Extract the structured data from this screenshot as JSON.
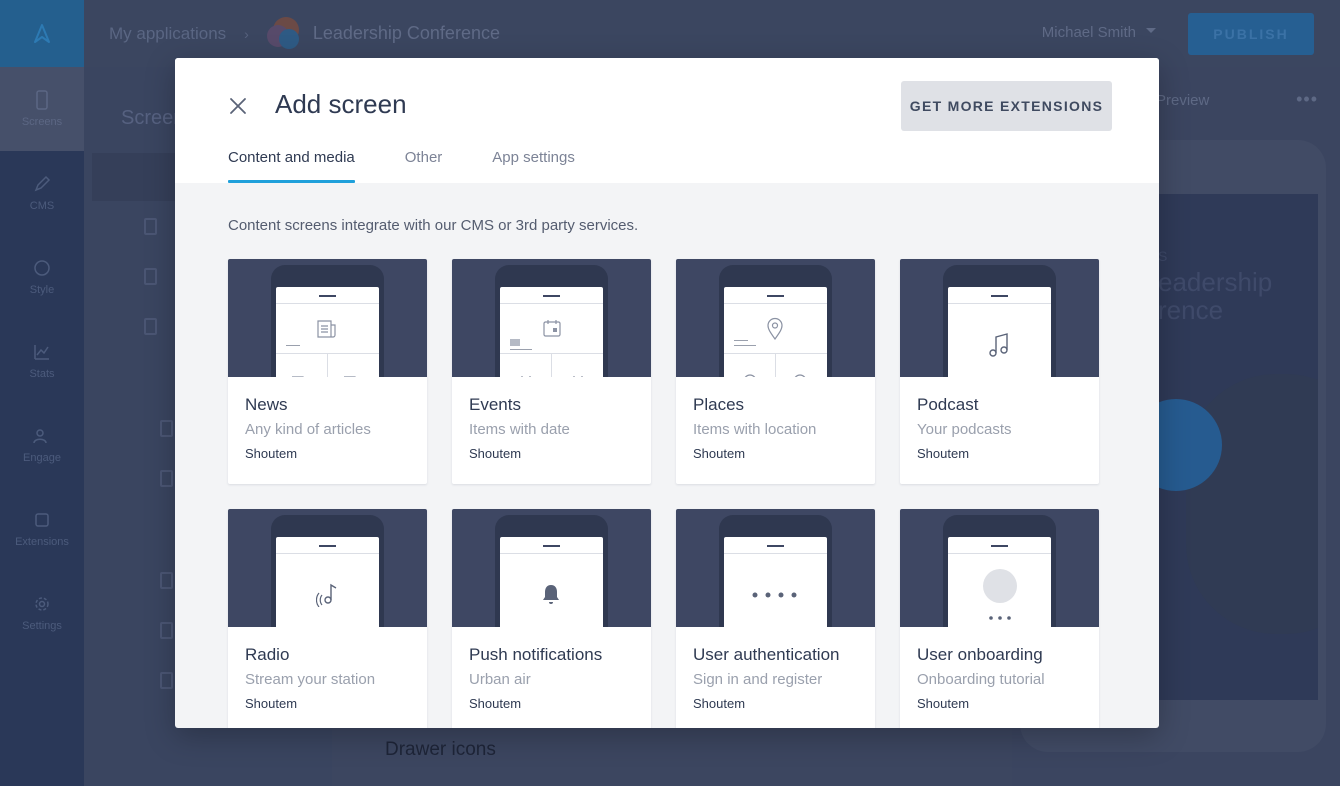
{
  "app": {
    "breadcrumb_root": "My applications",
    "app_name": "Leadership Conference",
    "user_name": "Michael Smith",
    "publish_label": "PUBLISH",
    "left_panel_title": "Screens",
    "section_label": "Drawer icons",
    "preview_label": "Preview",
    "preview_menu": "•••",
    "nav": [
      {
        "label": "Screens",
        "icon": "phone-icon"
      },
      {
        "label": "CMS",
        "icon": "pencil-icon"
      },
      {
        "label": "Style",
        "icon": "palette-icon"
      },
      {
        "label": "Stats",
        "icon": "chart-icon"
      },
      {
        "label": "Engage",
        "icon": "people-icon"
      },
      {
        "label": "Extensions",
        "icon": "puzzle-icon"
      },
      {
        "label": "Settings",
        "icon": "gear-icon"
      }
    ],
    "preview_text": [
      "S",
      "eadership",
      "rence"
    ]
  },
  "modal": {
    "title": "Add screen",
    "get_more_label": "GET MORE EXTENSIONS",
    "tabs": [
      {
        "label": "Content and media",
        "active": true
      },
      {
        "label": "Other",
        "active": false
      },
      {
        "label": "App settings",
        "active": false
      }
    ],
    "intro": "Content screens integrate with our CMS or 3rd party services.",
    "cards": [
      {
        "title": "News",
        "subtitle": "Any kind of articles",
        "author": "Shoutem",
        "icon": "article-icon"
      },
      {
        "title": "Events",
        "subtitle": "Items with date",
        "author": "Shoutem",
        "icon": "calendar-icon"
      },
      {
        "title": "Places",
        "subtitle": "Items with location",
        "author": "Shoutem",
        "icon": "location-pin-icon"
      },
      {
        "title": "Podcast",
        "subtitle": "Your podcasts",
        "author": "Shoutem",
        "icon": "music-note-icon"
      },
      {
        "title": "Radio",
        "subtitle": "Stream your station",
        "author": "Shoutem",
        "icon": "radio-icon"
      },
      {
        "title": "Push notifications",
        "subtitle": "Urban air",
        "author": "Shoutem",
        "icon": "bell-icon"
      },
      {
        "title": "User authentication",
        "subtitle": "Sign in and register",
        "author": "Shoutem",
        "icon": "password-dots-icon"
      },
      {
        "title": "User onboarding",
        "subtitle": "Onboarding tutorial",
        "author": "Shoutem",
        "icon": "onboarding-avatar-icon"
      }
    ]
  },
  "colors": {
    "accent": "#1fa0db",
    "modal_bg": "#f3f4f6",
    "thumb_bg": "#3e4763",
    "text_dark": "#2f3a52"
  }
}
